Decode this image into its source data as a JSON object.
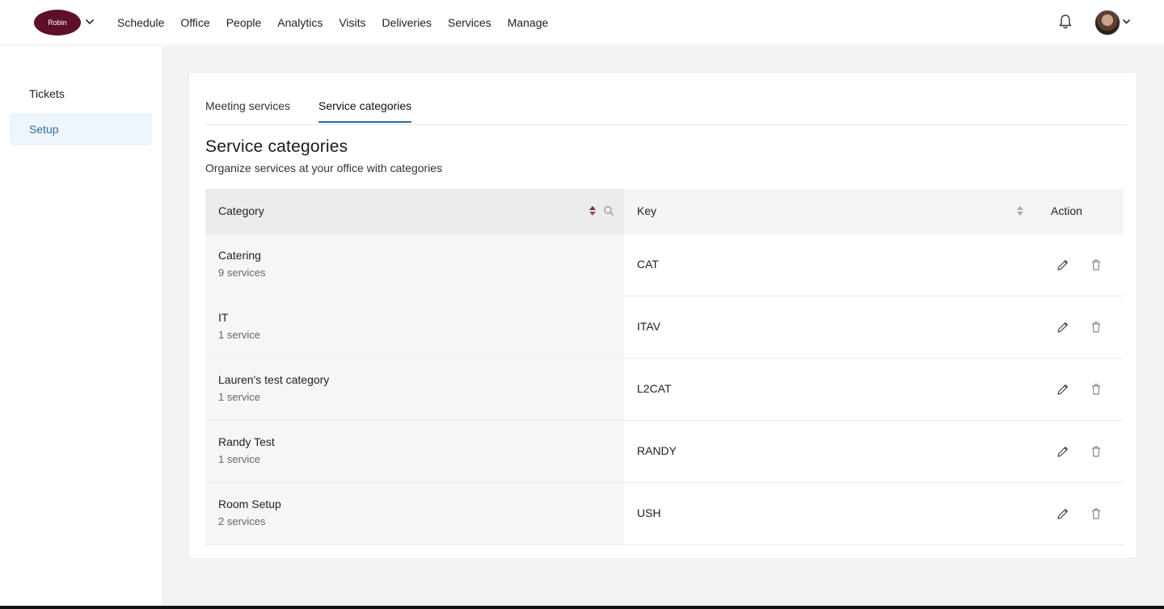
{
  "brand": {
    "logo_text": "Robin",
    "color": "#5e0f2c"
  },
  "nav": {
    "items": [
      "Schedule",
      "Office",
      "People",
      "Analytics",
      "Visits",
      "Deliveries",
      "Services",
      "Manage"
    ]
  },
  "icons": {
    "logo_menu": "chevron-down-icon",
    "notifications": "bell-icon",
    "avatar_menu": "chevron-down-icon"
  },
  "sidebar": {
    "items": [
      {
        "label": "Tickets",
        "active": false
      },
      {
        "label": "Setup",
        "active": true
      }
    ]
  },
  "tabs": [
    {
      "label": "Meeting services",
      "active": false
    },
    {
      "label": "Service categories",
      "active": true
    }
  ],
  "page": {
    "title": "Service categories",
    "subtitle": "Organize services at your office with categories"
  },
  "table": {
    "columns": {
      "category": "Category",
      "key": "Key",
      "action": "Action"
    },
    "rows": [
      {
        "name": "Catering",
        "count": "9 services",
        "key": "CAT"
      },
      {
        "name": "IT",
        "count": "1 service",
        "key": "ITAV"
      },
      {
        "name": "Lauren's test category",
        "count": "1 service",
        "key": "L2CAT"
      },
      {
        "name": "Randy Test",
        "count": "1 service",
        "key": "RANDY"
      },
      {
        "name": "Room Setup",
        "count": "2 services",
        "key": "USH"
      }
    ]
  },
  "colors": {
    "accent": "#2f6fa3",
    "active_bg": "#eef5fb",
    "page_bg": "#f3f3f3"
  }
}
